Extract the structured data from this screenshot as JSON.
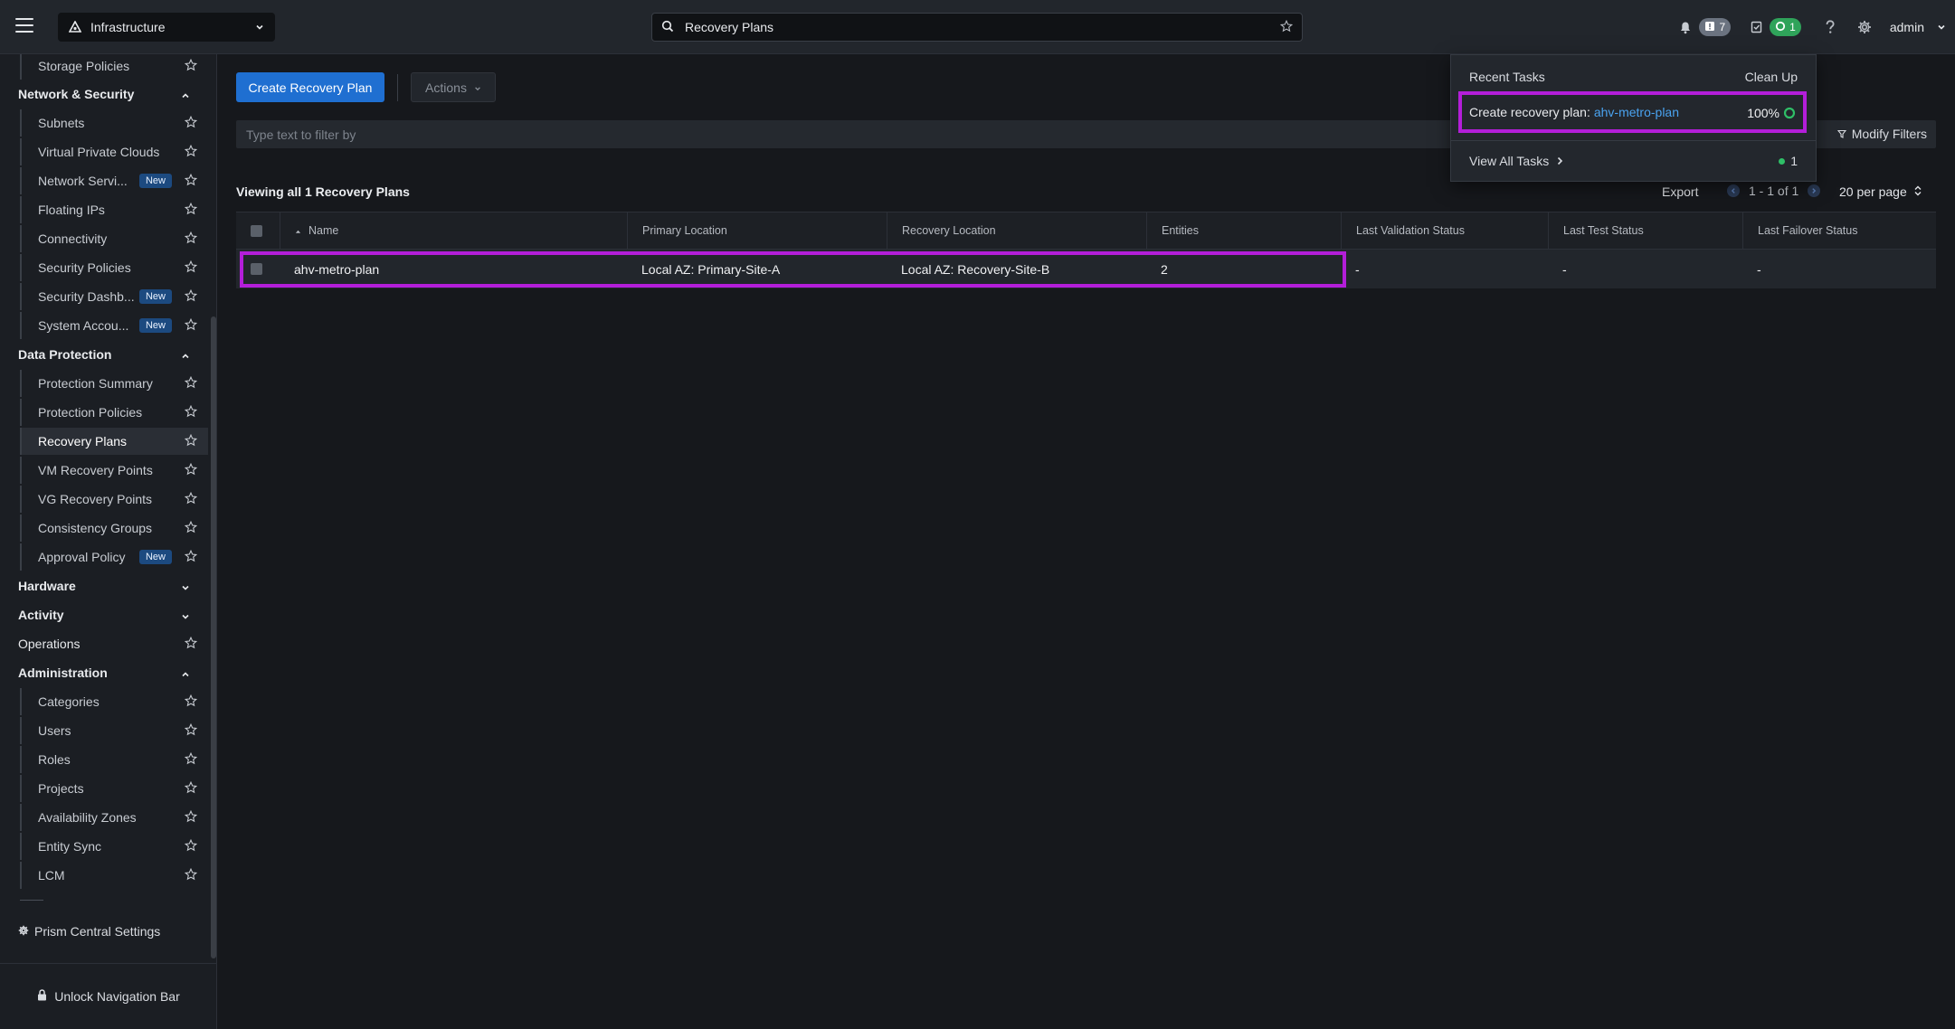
{
  "topbar": {
    "app_switcher": "Infrastructure",
    "search_value": "Recovery Plans",
    "alerts_count": "7",
    "tasks_count": "1",
    "user": "admin"
  },
  "sidebar": {
    "top_item": "Storage Policies",
    "network_group": "Network & Security",
    "network_items": [
      {
        "label": "Subnets",
        "badge": ""
      },
      {
        "label": "Virtual Private Clouds",
        "badge": ""
      },
      {
        "label": "Network Servi...",
        "badge": "New"
      },
      {
        "label": "Floating IPs",
        "badge": ""
      },
      {
        "label": "Connectivity",
        "badge": ""
      },
      {
        "label": "Security Policies",
        "badge": ""
      },
      {
        "label": "Security Dashb...",
        "badge": "New"
      },
      {
        "label": "System Accou...",
        "badge": "New"
      }
    ],
    "data_protection_group": "Data Protection",
    "data_protection_items": [
      {
        "label": "Protection Summary",
        "badge": ""
      },
      {
        "label": "Protection Policies",
        "badge": ""
      },
      {
        "label": "Recovery Plans",
        "badge": ""
      },
      {
        "label": "VM Recovery Points",
        "badge": ""
      },
      {
        "label": "VG Recovery Points",
        "badge": ""
      },
      {
        "label": "Consistency Groups",
        "badge": ""
      },
      {
        "label": "Approval Policy",
        "badge": "New"
      }
    ],
    "hardware_group": "Hardware",
    "activity_group": "Activity",
    "operations_group": "Operations",
    "administration_group": "Administration",
    "administration_items": [
      {
        "label": "Categories"
      },
      {
        "label": "Users"
      },
      {
        "label": "Roles"
      },
      {
        "label": "Projects"
      },
      {
        "label": "Availability Zones"
      },
      {
        "label": "Entity Sync"
      },
      {
        "label": "LCM"
      }
    ],
    "settings_link": "Prism Central Settings",
    "unlock_label": "Unlock Navigation Bar"
  },
  "main": {
    "create_button": "Create Recovery Plan",
    "actions_button": "Actions",
    "filter_placeholder": "Type text to filter by",
    "modify_filters": "Modify Filters",
    "viewing_text": "Viewing all 1 Recovery Plans",
    "export": "Export",
    "pagination": "1 - 1 of 1",
    "per_page": "20 per page",
    "columns": [
      "Name",
      "Primary Location",
      "Recovery Location",
      "Entities",
      "Last Validation Status",
      "Last Test Status",
      "Last Failover Status"
    ],
    "rows": [
      {
        "name": "ahv-metro-plan",
        "primary": "Local AZ: Primary-Site-A",
        "recovery": "Local AZ: Recovery-Site-B",
        "entities": "2",
        "validation": "-",
        "test": "-",
        "failover": "-"
      }
    ]
  },
  "tasks_popover": {
    "title": "Recent Tasks",
    "clean_up": "Clean Up",
    "task_prefix": "Create recovery plan:",
    "task_link": "ahv-metro-plan",
    "task_percent": "100%",
    "view_all": "View All Tasks",
    "running_count": "1"
  },
  "colors": {
    "accent": "#1f6fd1",
    "highlight": "#b31ed9",
    "success": "#2fa35a",
    "link": "#4aa3f0"
  }
}
